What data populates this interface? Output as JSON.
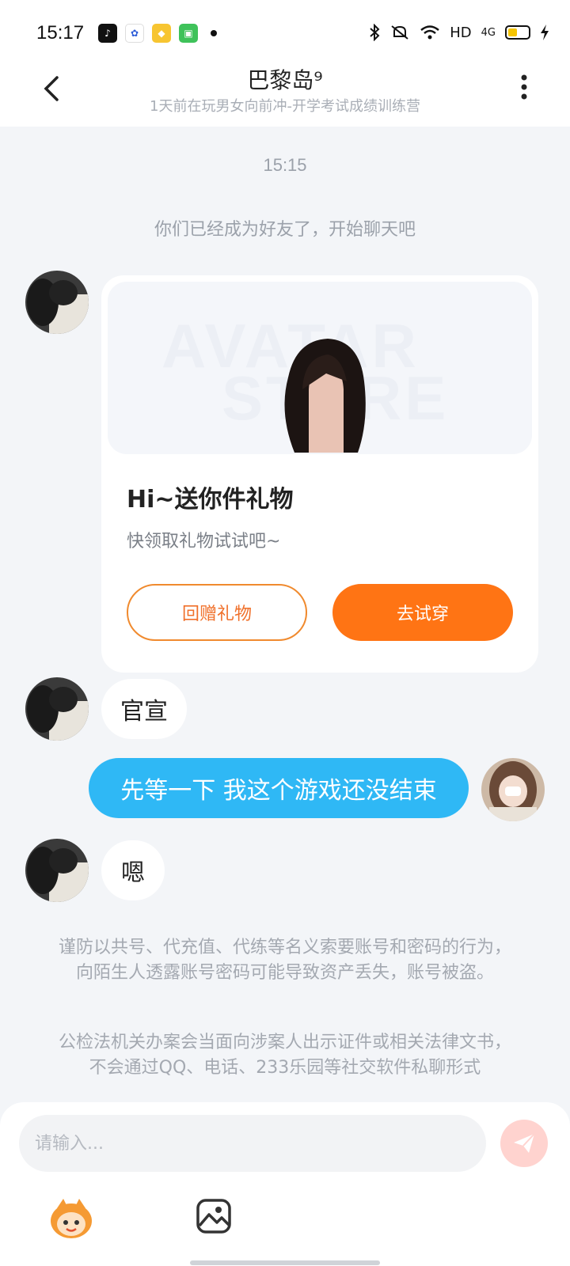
{
  "status_bar": {
    "time": "15:17",
    "network": "HD",
    "signal_label": "4G"
  },
  "header": {
    "title": "巴黎岛⁹",
    "subtitle": "1天前在玩男女向前冲-开学考试成绩训练营"
  },
  "chat": {
    "timestamp": "15:15",
    "system_message": "你们已经成为好友了，开始聊天吧",
    "gift_card": {
      "watermark_line1": "AVATAR",
      "watermark_line2": "STORE",
      "title": "Hi~送你件礼物",
      "subtitle": "快领取礼物试试吧~",
      "return_button": "回赠礼物",
      "try_button": "去试穿"
    },
    "messages": [
      {
        "side": "left",
        "text": "官宣"
      },
      {
        "side": "right",
        "text": "先等一下 我这个游戏还没结束"
      },
      {
        "side": "left",
        "text": "嗯"
      }
    ],
    "notices": [
      "谨防以共号、代充值、代练等名义索要账号和密码的行为，向陌生人透露账号密码可能导致资产丢失，账号被盗。",
      "公检法机关办案会当面向涉案人出示证件或相关法律文书，不会通过QQ、电话、233乐园等社交软件私聊形式"
    ]
  },
  "input": {
    "placeholder": "请输入..."
  },
  "colors": {
    "accent_orange": "#ff7414",
    "bubble_blue": "#2fb8f5",
    "background": "#f3f5f8"
  },
  "icons": [
    "back-icon",
    "more-icon",
    "send-icon",
    "emoji-mascot-icon",
    "image-icon",
    "bluetooth-icon",
    "mute-icon",
    "wifi-icon",
    "battery-icon"
  ]
}
